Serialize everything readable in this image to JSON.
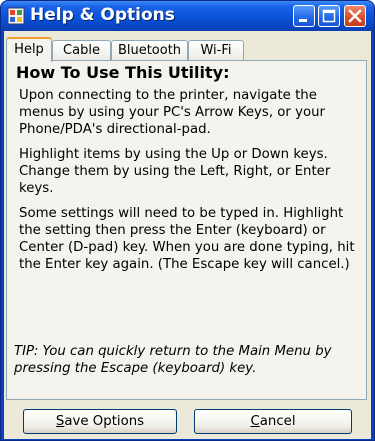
{
  "window": {
    "title": "Help & Options"
  },
  "titlebar_buttons": {
    "minimize_icon": "minimize-icon",
    "maximize_icon": "maximize-icon",
    "close_icon": "close-icon"
  },
  "tabs": [
    {
      "label": "Help",
      "active": true
    },
    {
      "label": "Cable",
      "active": false
    },
    {
      "label": "Bluetooth",
      "active": false
    },
    {
      "label": "Wi-Fi",
      "active": false
    }
  ],
  "help": {
    "heading": "How To Use This Utility:",
    "paragraphs": [
      "Upon connecting to the printer, navigate the menus by using your PC's Arrow Keys, or your Phone/PDA's directional-pad.",
      "Highlight items by using the Up or Down keys. Change them by using the Left, Right, or Enter keys.",
      "Some settings will need to be typed in. Highlight the setting then press the Enter (keyboard) or Center (D-pad) key. When you are done typing, hit the Enter key again. (The Escape key will cancel.)"
    ],
    "tip": "TIP: You can quickly return to the Main Menu by pressing the Escape (keyboard) key."
  },
  "buttons": {
    "save_mnemonic": "S",
    "save_rest": "ave Options",
    "cancel_mnemonic": "C",
    "cancel_rest": "ancel"
  },
  "colors": {
    "titlebar": "#0b52d8",
    "dialog_face": "#ece9d8",
    "tab_highlight": "#f0a030",
    "close_button": "#d9502c"
  }
}
